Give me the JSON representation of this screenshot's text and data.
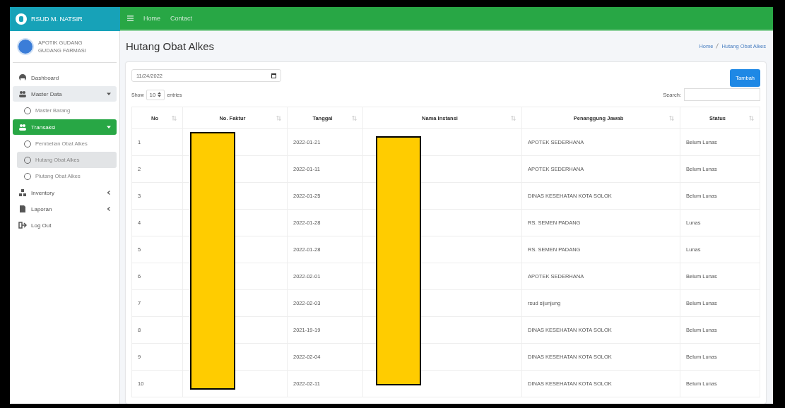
{
  "brand": {
    "title": "RSUD M. NATSIR"
  },
  "topnav": [
    "Home",
    "Contact"
  ],
  "user": {
    "line1": "APOTIK GUDANG",
    "line2": "GUDANG FARMASI"
  },
  "sidebar": {
    "items": [
      {
        "label": "Dashboard",
        "selected": false
      },
      {
        "label": "Master Data",
        "selected": false,
        "expanded": true,
        "children": [
          {
            "label": "Master Barang",
            "selected": false
          }
        ]
      },
      {
        "label": "Transaksi",
        "selected": true,
        "expanded": true,
        "children": [
          {
            "label": "Pembelian Obat Alkes",
            "selected": false
          },
          {
            "label": "Hutang Obat Alkes",
            "selected": true
          },
          {
            "label": "Piutang Obat Alkes",
            "selected": false
          }
        ]
      },
      {
        "label": "Inventory",
        "selected": false,
        "expanded": false
      },
      {
        "label": "Laporan",
        "selected": false,
        "expanded": false
      },
      {
        "label": "Log Out",
        "selected": false
      }
    ]
  },
  "page": {
    "title": "Hutang Obat Alkes",
    "breadcrumb": [
      "Home",
      "Hutang Obat Alkes"
    ]
  },
  "filter": {
    "date": "11/24/2022",
    "show_label": "Show",
    "entries_value": "10",
    "entries_label": "entries",
    "search_label": "Search:",
    "add_button": "Tambah"
  },
  "table": {
    "columns": [
      "No",
      "No. Faktur",
      "Tanggal",
      "Nama Instansi",
      "Penanggung Jawab",
      "Status"
    ],
    "rows": [
      [
        "1",
        "",
        "2022-01-21",
        "",
        "APOTEK SEDERHANA",
        "Belum Lunas"
      ],
      [
        "2",
        "",
        "2022-01-11",
        "",
        "APOTEK SEDERHANA",
        "Belum Lunas"
      ],
      [
        "3",
        "",
        "2022-01-25",
        "",
        "DINAS KESEHATAN KOTA SOLOK",
        "Belum Lunas"
      ],
      [
        "4",
        "",
        "2022-01-28",
        "",
        "RS. SEMEN PADANG",
        "Lunas"
      ],
      [
        "5",
        "",
        "2022-01-28",
        "",
        "RS. SEMEN PADANG",
        "Lunas"
      ],
      [
        "6",
        "",
        "2022-02-01",
        "",
        "APOTEK SEDERHANA",
        "Belum Lunas"
      ],
      [
        "7",
        "",
        "2022-02-03",
        "",
        "rsud sijunjung",
        "Belum Lunas"
      ],
      [
        "8",
        "",
        "2021-19-19",
        "",
        "DINAS KESEHATAN KOTA SOLOK",
        "Belum Lunas"
      ],
      [
        "9",
        "",
        "2022-02-04",
        "",
        "DINAS KESEHATAN KOTA SOLOK",
        "Belum Lunas"
      ],
      [
        "10",
        "",
        "2022-02-11",
        "",
        "DINAS KESEHATAN KOTA SOLOK",
        "Belum Lunas"
      ]
    ]
  }
}
